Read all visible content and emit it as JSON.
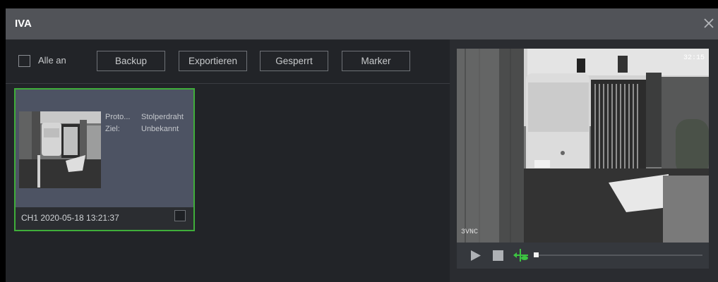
{
  "window": {
    "title": "IVA",
    "close_icon": "close-icon"
  },
  "toolbar": {
    "select_all_label": "Alle an",
    "buttons": [
      "Backup",
      "Exportieren",
      "Gesperrt",
      "Marker"
    ]
  },
  "event_card": {
    "protocol_label": "Proto...",
    "protocol_value": "Stolperdraht",
    "target_label": "Ziel:",
    "target_value": "Unbekannt",
    "timestamp": "CH1 2020-05-18 13:21:37"
  },
  "video": {
    "overlay_text": "3VNC",
    "top_right_text": "32:15"
  },
  "player": {
    "icons": [
      "play-icon",
      "stop-icon",
      "clip-icon"
    ]
  },
  "colors": {
    "accent": "#3fae3a",
    "titlebar": "#515358",
    "background": "#222428"
  }
}
